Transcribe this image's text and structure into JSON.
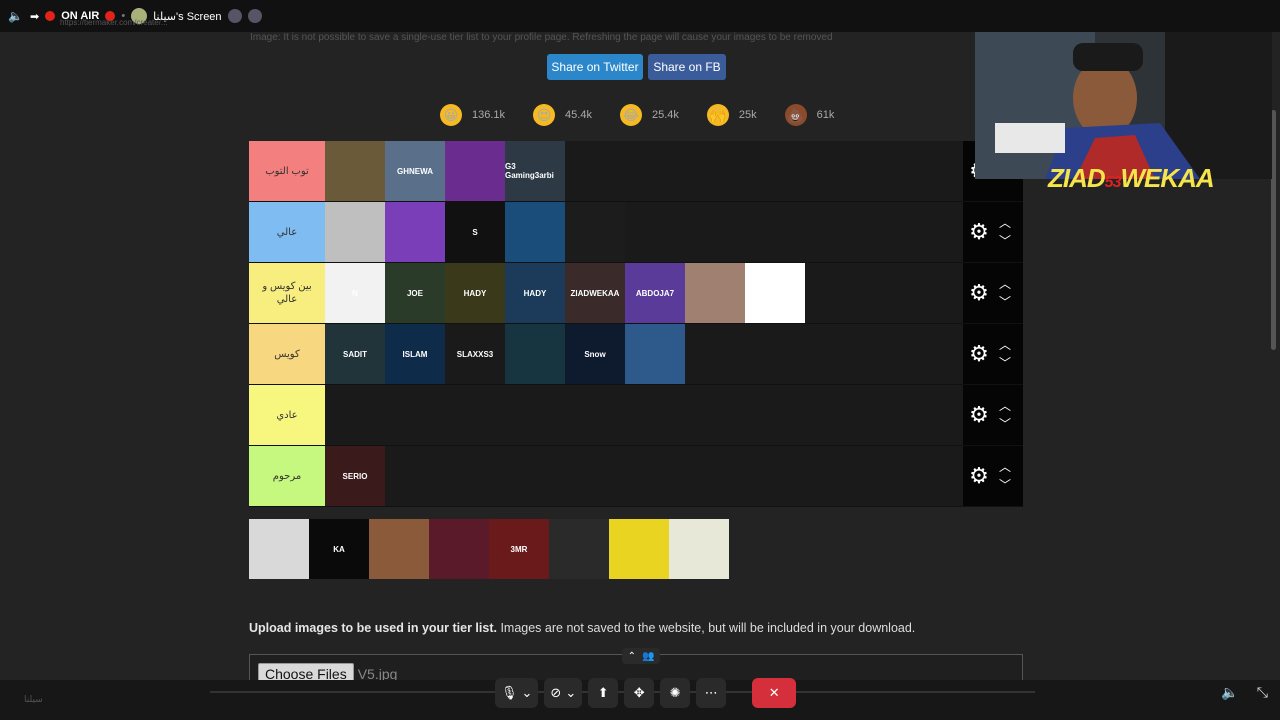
{
  "topbar": {
    "on_air": "ON AIR",
    "screen_title": "سيلنا's Screen"
  },
  "url": "https://tiermaker.com/create/...",
  "page": {
    "top_note": "Image: It is not possible to save a single-use tier list to your profile page. Refreshing the page will cause your images to be removed",
    "share_twitter": "Share on Twitter",
    "share_fb": "Share on FB",
    "reactions": [
      {
        "emoji": "😀",
        "count": "136.1k",
        "color": "#f5b921"
      },
      {
        "emoji": "😍",
        "count": "45.4k",
        "color": "#f5b921"
      },
      {
        "emoji": "😂",
        "count": "25.4k",
        "color": "#f5b921"
      },
      {
        "emoji": "🙌",
        "count": "25k",
        "color": "#f5b921"
      },
      {
        "emoji": "💩",
        "count": "61k",
        "color": "#8b4a2b"
      }
    ]
  },
  "tiers": [
    {
      "label": "توب التوب",
      "color": "#f47f7f",
      "items": [
        {
          "text": "",
          "bg": "#6b5a3a"
        },
        {
          "text": "GHNEWA",
          "bg": "#5a6f8a"
        },
        {
          "text": "",
          "bg": "#6a2c8f"
        },
        {
          "text": "G3 Gaming3arbi",
          "bg": "#2d3a46"
        }
      ]
    },
    {
      "label": "عالي",
      "color": "#7fbcf2",
      "items": [
        {
          "text": "",
          "bg": "#bfbfbf"
        },
        {
          "text": "",
          "bg": "#7a3fb8"
        },
        {
          "text": "S",
          "bg": "#111111"
        },
        {
          "text": "",
          "bg": "#1b4d7a"
        },
        {
          "text": "",
          "bg": "#1c1c1c"
        }
      ]
    },
    {
      "label": "بين كويس و عالي",
      "color": "#f7ee7f",
      "items": [
        {
          "text": "N",
          "bg": "#f2f2f2"
        },
        {
          "text": "JOE",
          "bg": "#2a3b2a"
        },
        {
          "text": "HADY",
          "bg": "#3a3a1a"
        },
        {
          "text": "HADY",
          "bg": "#1c3b5a"
        },
        {
          "text": "ZIADWEKAA",
          "bg": "#3a2a2a"
        },
        {
          "text": "ABDOJA7",
          "bg": "#5a3b9a"
        },
        {
          "text": "",
          "bg": "#a08070"
        },
        {
          "text": "",
          "bg": "#ffffff"
        }
      ]
    },
    {
      "label": "كويس",
      "color": "#f7d77f",
      "items": [
        {
          "text": "SADIT",
          "bg": "#20343a"
        },
        {
          "text": "ISLAM",
          "bg": "#0f2b4a"
        },
        {
          "text": "SLAXXS3",
          "bg": "#1a1a1a"
        },
        {
          "text": "",
          "bg": "#163540"
        },
        {
          "text": "Snow",
          "bg": "#0e1a2e"
        },
        {
          "text": "",
          "bg": "#2d5a8a"
        }
      ]
    },
    {
      "label": "عادي",
      "color": "#f7f77f",
      "items": []
    },
    {
      "label": "مرحوم",
      "color": "#c6f77f",
      "items": [
        {
          "text": "SERIO",
          "bg": "#3a1a1a"
        }
      ]
    }
  ],
  "pool": [
    {
      "text": "",
      "bg": "#d9d9d9"
    },
    {
      "text": "KA",
      "bg": "#0a0a0a"
    },
    {
      "text": "",
      "bg": "#8a5a3a"
    },
    {
      "text": "",
      "bg": "#5a1a2a"
    },
    {
      "text": "3MR",
      "bg": "#6a1a1a"
    },
    {
      "text": "",
      "bg": "#2a2a2a"
    },
    {
      "text": "",
      "bg": "#e9d521"
    },
    {
      "text": "",
      "bg": "#e8e8d8"
    }
  ],
  "upload": {
    "bold": "Upload images to be used in your tier list.",
    "rest": " Images are not saved to the website, but will be included in your download.",
    "choose": "Choose Files",
    "filename": "V5.jpg"
  },
  "cam": {
    "name_a": "ZIAD",
    "name_b": "WEKAA",
    "num": "53"
  },
  "taskbar_text": "سيلنا"
}
